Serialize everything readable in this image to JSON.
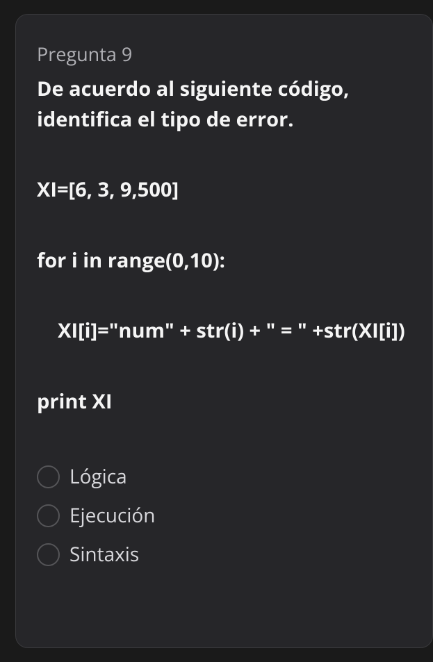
{
  "question": {
    "label": "Pregunta 9",
    "title": "De acuerdo al siguiente código, identifica el tipo de error.",
    "code": {
      "line1": "XI=[6, 3, 9,500]",
      "line2": "for i in range(0,10):",
      "line3": "    XI[i]=\"num\" + str(i) + \" = \" +str(XI[i])",
      "line4": "print XI"
    },
    "options": [
      {
        "label": "Lógica"
      },
      {
        "label": "Ejecución"
      },
      {
        "label": "Sintaxis"
      }
    ]
  }
}
